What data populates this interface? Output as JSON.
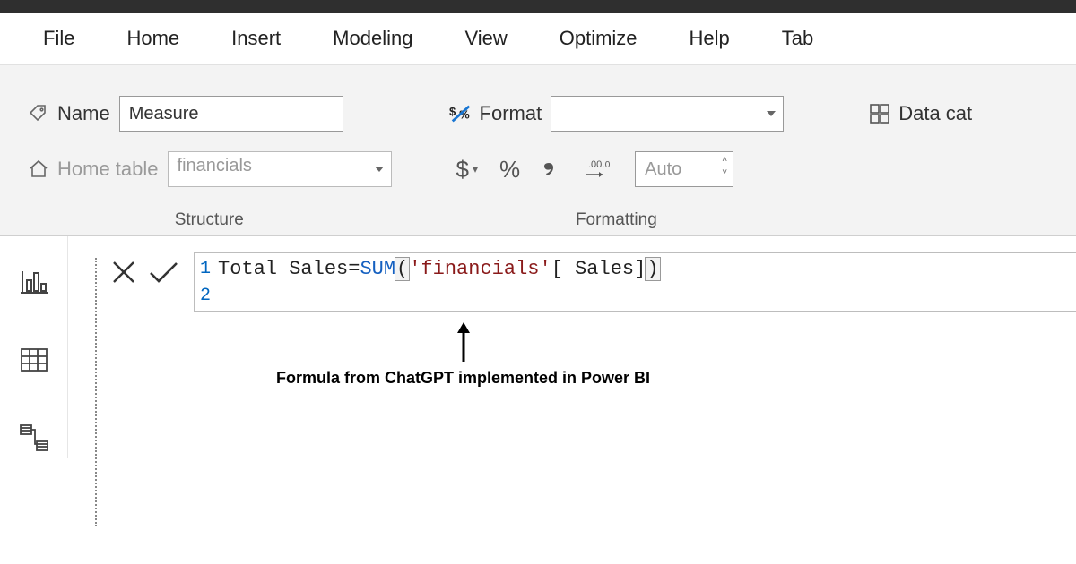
{
  "ribbon": {
    "tabs": [
      "File",
      "Home",
      "Insert",
      "Modeling",
      "View",
      "Optimize",
      "Help",
      "Tab"
    ]
  },
  "structure_group": {
    "name_label": "Name",
    "name_value": "Measure",
    "home_table_label": "Home table",
    "home_table_value": "financials",
    "title": "Structure"
  },
  "formatting_group": {
    "format_label": "Format",
    "format_value": "",
    "currency_symbol": "$",
    "percent_symbol": "%",
    "thousands_symbol": ",",
    "decimals_value": "Auto",
    "title": "Formatting"
  },
  "properties_group": {
    "data_category_label": "Data cat"
  },
  "formula": {
    "line1_parts": {
      "measure_name": "Total Sales",
      "equals": " = ",
      "func": "SUM",
      "open": "(",
      "table_ref": "'financials'",
      "col_ref": "[ Sales]",
      "close": ")"
    },
    "full_text": "Total Sales = SUM('financials'[ Sales])",
    "line_numbers": [
      "1",
      "2"
    ]
  },
  "annotation": {
    "text": "Formula from ChatGPT implemented in Power BI"
  }
}
